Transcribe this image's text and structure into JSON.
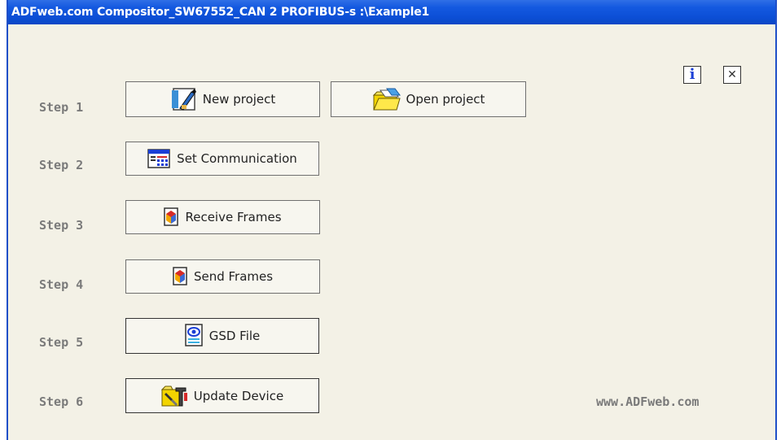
{
  "window": {
    "title": "ADFweb.com Compositor_SW67552_CAN 2 PROFIBUS-s :\\Example1"
  },
  "controls": {
    "info_icon": "info-icon",
    "close_icon": "close-icon"
  },
  "steps": [
    {
      "label": "Step 1",
      "buttons": [
        {
          "text": "New project",
          "icon": "new-project-icon"
        },
        {
          "text": "Open project",
          "icon": "open-folder-icon"
        }
      ]
    },
    {
      "label": "Step 2",
      "buttons": [
        {
          "text": "Set Communication",
          "icon": "set-communication-icon"
        }
      ]
    },
    {
      "label": "Step 3",
      "buttons": [
        {
          "text": "Receive Frames",
          "icon": "frames-icon"
        }
      ]
    },
    {
      "label": "Step 4",
      "buttons": [
        {
          "text": "Send Frames",
          "icon": "frames-icon"
        }
      ]
    },
    {
      "label": "Step 5",
      "buttons": [
        {
          "text": "GSD File",
          "icon": "gsd-file-icon"
        }
      ]
    },
    {
      "label": "Step 6",
      "buttons": [
        {
          "text": "Update Device",
          "icon": "update-device-icon"
        }
      ]
    }
  ],
  "footer": {
    "website": "www.ADFweb.com"
  }
}
